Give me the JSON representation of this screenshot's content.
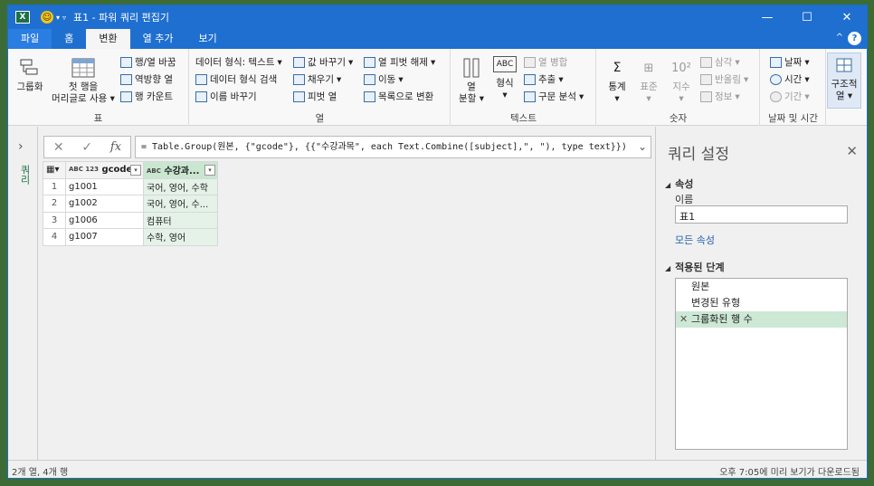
{
  "window": {
    "title": "표1 - 파워 쿼리 편집기",
    "app_icon": "X"
  },
  "tabs": {
    "file": "파일",
    "home": "홈",
    "transform": "변환",
    "add_column": "열 추가",
    "view": "보기"
  },
  "ribbon": {
    "table": {
      "label": "표",
      "group_by": "그룹화",
      "first_row": "첫 행을",
      "use_as_header": "머리글로 사용",
      "transpose": "행/열 바꿈",
      "reverse": "역방향 열",
      "count_rows": "행 카운트"
    },
    "column": {
      "label": "열",
      "data_type": "데이터 형식: 텍스트",
      "detect_type": "데이터 형식 검색",
      "rename": "이름 바꾸기",
      "replace": "값 바꾸기",
      "fill": "채우기",
      "pivot": "피벗 열",
      "unpivot": "열 피벗 해제",
      "move": "이동",
      "to_list": "목록으로 변환"
    },
    "text": {
      "label": "텍스트",
      "split": "열",
      "split2": "분할",
      "format": "형식",
      "merge": "열 병합",
      "extract": "추출",
      "parse": "구문 분석"
    },
    "number": {
      "label": "숫자",
      "stats": "통계",
      "standard": "표준",
      "exponent": "지수",
      "trig": "삼각",
      "rounding": "반올림",
      "info": "정보"
    },
    "datetime": {
      "label": "날짜 및 시간",
      "date": "날짜",
      "time": "시간",
      "duration": "기간"
    },
    "structured": {
      "label": "구조적",
      "label2": "열"
    }
  },
  "left_pane": {
    "queries": "쿼리"
  },
  "formula": "= Table.Group(원본, {\"gcode\"}, {{\"수강과목\", each Text.Combine([subject],\", \"), type text}})",
  "grid": {
    "col1": "gcode",
    "col1_type": "ABC 123",
    "col2": "수강과...",
    "col2_type": "ABC",
    "rows": [
      {
        "n": "1",
        "gcode": "g1001",
        "subj": "국어, 영어, 수학"
      },
      {
        "n": "2",
        "gcode": "g1002",
        "subj": "국어, 영어, 수..."
      },
      {
        "n": "3",
        "gcode": "g1006",
        "subj": "컴퓨터"
      },
      {
        "n": "4",
        "gcode": "g1007",
        "subj": "수학, 영어"
      }
    ]
  },
  "settings": {
    "title": "쿼리 설정",
    "props": "속성",
    "name_label": "이름",
    "name_value": "표1",
    "all_props": "모든 속성",
    "applied": "적용된 단계",
    "steps": [
      "원본",
      "변경된 유형",
      "그룹화된 행 수"
    ]
  },
  "status": {
    "left": "2개 열, 4개 행",
    "right": "오후 7:05에 미리 보기가 다운로드됨"
  }
}
